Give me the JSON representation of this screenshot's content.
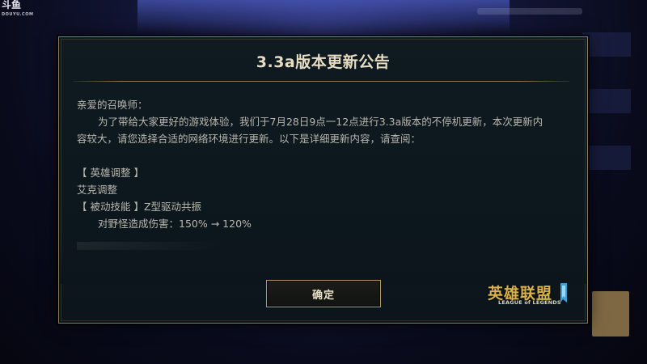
{
  "watermark": {
    "brand": "斗鱼",
    "site": "DOUYU.COM"
  },
  "dialog": {
    "title": "3.3a版本更新公告",
    "greeting": "亲爱的召唤师：",
    "intro_line_1": "为了带给大家更好的游戏体验，我们于7月28日9点一12点进行3.3a版本的不停机更新，本次更新内",
    "intro_line_2": "容较大，请您选择合适的网络环境进行更新。以下是详细更新内容，请查阅：",
    "section_heading": "【 英雄调整 】",
    "hero_name": "艾克调整",
    "skill_line": "【 被动技能 】Z型驱动共振",
    "change_line": "对野怪造成伤害：150% → 120%",
    "confirm_label": "确定"
  },
  "logo": {
    "cn": "英雄联盟",
    "en": "LEAGUE of LEGENDS"
  },
  "colors": {
    "accent_gold": "#8c7a52",
    "title_text": "#e6dcc2",
    "body_text": "#b9b7ad",
    "logo_gold": "#d9b24a",
    "dialog_bg": "#0f1a21"
  }
}
